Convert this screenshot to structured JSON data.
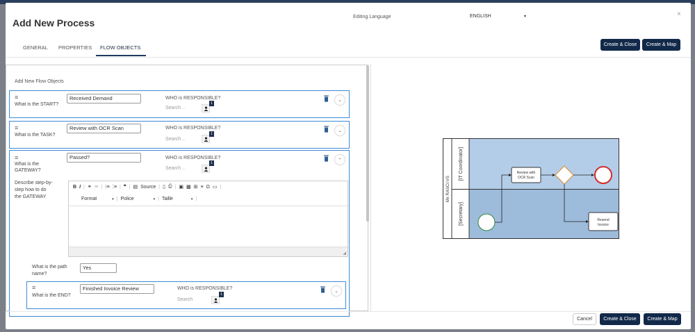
{
  "modal": {
    "title": "Add New Process",
    "close_icon": "×"
  },
  "language": {
    "label": "Editing Language",
    "value": "ENGLISH",
    "caret": "▾"
  },
  "tabs": [
    {
      "label": "GENERAL"
    },
    {
      "label": "PROPERTIES"
    },
    {
      "label": "FLOW OBJECTS"
    }
  ],
  "header_buttons": {
    "create_close": "Create & Close",
    "create_map": "Create & Map"
  },
  "flow": {
    "section_label": "Add New Flow Objects",
    "who_label": "WHO is RESPONSIBLE?",
    "search_placeholder": "Search ..",
    "search_placeholder_end": "Search",
    "user_count": "1",
    "start": {
      "question": "What is the START?",
      "value": "Received Demand"
    },
    "task": {
      "question": "What is the TASK?",
      "value": "Review with OCR Scan"
    },
    "gateway": {
      "question_line1": "What is the",
      "question_line2": "GATEWAY?",
      "value": "Passed?",
      "describe_line1": "Describe step-by-",
      "describe_line2": "step how to do",
      "describe_line3": "the GATEWAY",
      "path_label_line1": "What is the path",
      "path_label_line2": "name?",
      "path_value": "Yes"
    },
    "end": {
      "question": "What is the END?",
      "value": "Finished Invoice Review"
    }
  },
  "editor_toolbar": {
    "bold": "B",
    "italic": "I",
    "source": "Source",
    "format": "Format",
    "police": "Police",
    "taille": "Taille",
    "caret": "▾"
  },
  "diagram": {
    "pool_label": "Mx RASCI-VS",
    "lane1": "[IT Coordinator]",
    "lane2": "[Secretary]",
    "task_line1": "Review with",
    "task_line2": "OCR Scan",
    "resend_line1": "Resend",
    "resend_line2": "Invoice",
    "lane1_color": "#b3cde8",
    "lane2_color": "#9dbbdb"
  },
  "footer": {
    "cancel": "Cancel",
    "create_close": "Create & Close",
    "create_map": "Create & Map"
  }
}
